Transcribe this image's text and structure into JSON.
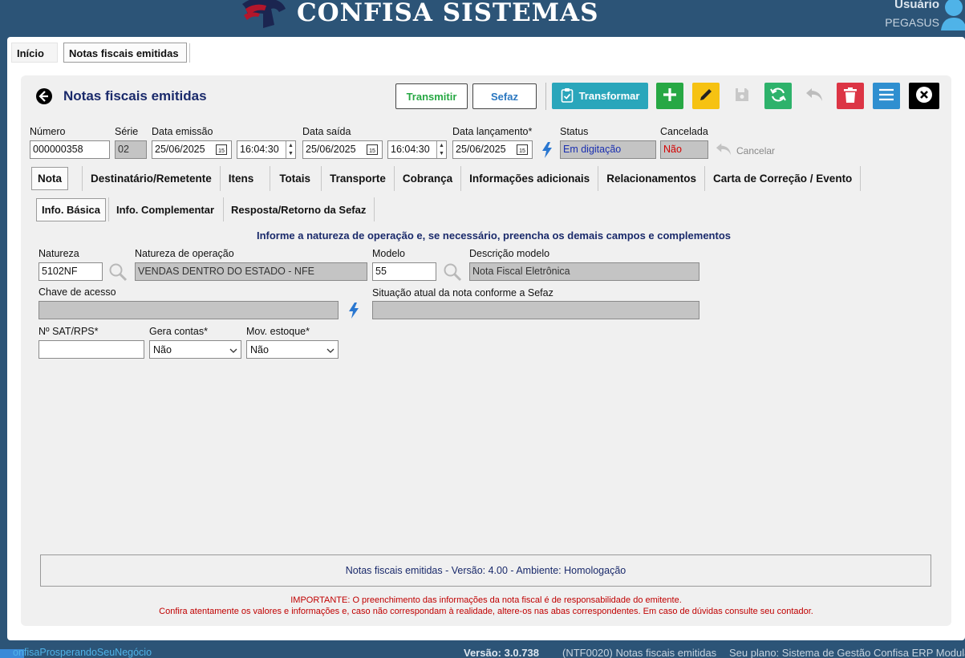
{
  "app": {
    "brand": "CONFISA SISTEMAS",
    "user_label": "Usuário",
    "user_name": "PEGASUS"
  },
  "tabs": [
    {
      "label": "Início"
    },
    {
      "label": "Notas fiscais emitidas"
    }
  ],
  "header": {
    "title": "Notas fiscais emitidas",
    "buttons": {
      "transmitir": "Transmitir",
      "sefaz": "Sefaz",
      "transformar": "Transformar"
    }
  },
  "form": {
    "numero": {
      "label": "Número",
      "value": "000000358"
    },
    "serie": {
      "label": "Série",
      "value": "02"
    },
    "data_emissao": {
      "label": "Data emissão",
      "value": "25/06/2025",
      "time": "16:04:30"
    },
    "data_saida": {
      "label": "Data saída",
      "value": "25/06/2025",
      "time": "16:04:30"
    },
    "data_lancamento": {
      "label": "Data lançamento*",
      "value": "25/06/2025"
    },
    "status": {
      "label": "Status",
      "value": "Em digitação"
    },
    "cancelada": {
      "label": "Cancelada",
      "value": "Não"
    },
    "cancelar_label": "Cancelar"
  },
  "doc_tabs": [
    "Nota",
    "Destinatário/Remetente",
    "Itens",
    "Totais",
    "Transporte",
    "Cobrança",
    "Informações adicionais",
    "Relacionamentos",
    "Carta de Correção / Evento"
  ],
  "sub_tabs": [
    "Info. Básica",
    "Info. Complementar",
    "Resposta/Retorno da Sefaz"
  ],
  "info": {
    "hint": "Informe a natureza de operação e, se necessário, preencha os demais campos e complementos",
    "natureza": {
      "label": "Natureza",
      "value": "5102NF"
    },
    "natureza_operacao": {
      "label": "Natureza de operação",
      "value": "VENDAS DENTRO DO ESTADO - NFE"
    },
    "modelo": {
      "label": "Modelo",
      "value": "55"
    },
    "descricao_modelo": {
      "label": "Descrição modelo",
      "value": "Nota Fiscal Eletrônica"
    },
    "chave_acesso": {
      "label": "Chave de acesso",
      "value": ""
    },
    "situacao": {
      "label": "Situação atual da nota conforme a Sefaz",
      "value": ""
    },
    "sat_rps": {
      "label": "Nº SAT/RPS*",
      "value": ""
    },
    "gera_contas": {
      "label": "Gera contas*",
      "value": "Não"
    },
    "mov_estoque": {
      "label": "Mov. estoque*",
      "value": "Não"
    }
  },
  "footer": {
    "version_line": "Notas fiscais emitidas - Versão: 4.00 - Ambiente: Homologação",
    "warning1": "IMPORTANTE: O preenchimento das informações da nota fiscal é de responsabilidade do emitente.",
    "warning2": "Confira atentamente os valores e informações e, caso não correspondam à realidade, altere-os nas abas correspondentes. Em caso de dúvidas consulte seu contador."
  },
  "statusbar": {
    "tagline": "onfisaProsperandoSeuNegócio",
    "version": "Versão: 3.0.738",
    "screen": "(NTF0020) Notas fiscais emitidas",
    "plan": "Seu plano: Sistema de Gestão Confisa ERP Modular"
  },
  "colors": {
    "header_bg": "#2c5477",
    "title": "#1a2a6b",
    "transformar": "#2aa6bb",
    "add": "#27a844",
    "edit": "#f6c212",
    "refresh": "#2eb26b",
    "delete": "#dc3545",
    "menu": "#2f8fd0",
    "close": "#000000"
  }
}
